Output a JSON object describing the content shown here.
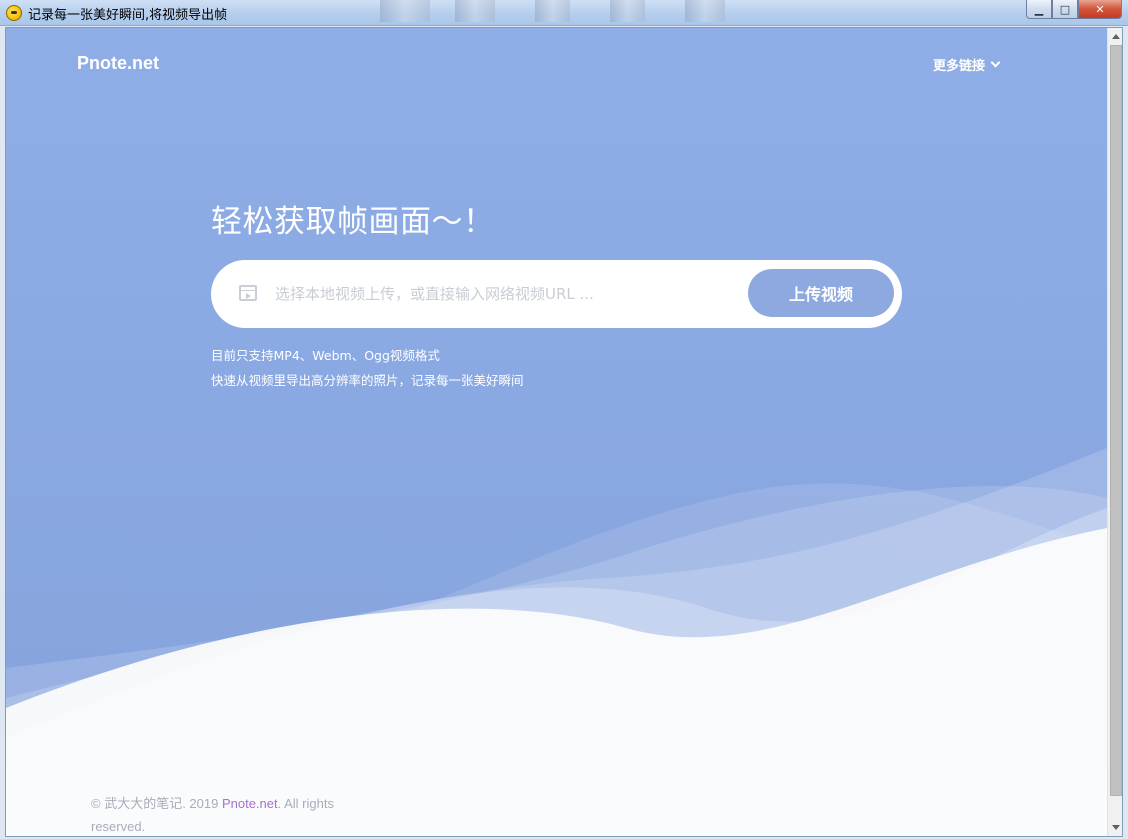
{
  "window": {
    "title": "记录每一张美好瞬间,将视频导出帧",
    "minimize_label": "▁",
    "maximize_label": "□",
    "close_label": "✕"
  },
  "header": {
    "logo": "Pnote.net",
    "more_links": "更多链接"
  },
  "hero": {
    "headline": "轻松获取帧画面～！",
    "upload": {
      "placeholder": "选择本地视频上传，或直接输入网络视频URL ...",
      "value": "",
      "button_label": "上传视频"
    },
    "notes": [
      "目前只支持MP4、Webm、Ogg视频格式",
      "快速从视频里导出高分辨率的照片，记录每一张美好瞬间"
    ]
  },
  "footer": {
    "copyright_prefix": "© 武大大的笔记. 2019 ",
    "brand": "Pnote.net",
    "copyright_suffix": ". All rights reserved."
  },
  "colors": {
    "hero_blue": "#8aa8e2",
    "button_blue": "#8ea9e0",
    "brand_purple": "#a472cf"
  },
  "icons": {
    "upload_field_icon": "video-file-icon",
    "more_links_icon": "chevron-down-icon"
  }
}
